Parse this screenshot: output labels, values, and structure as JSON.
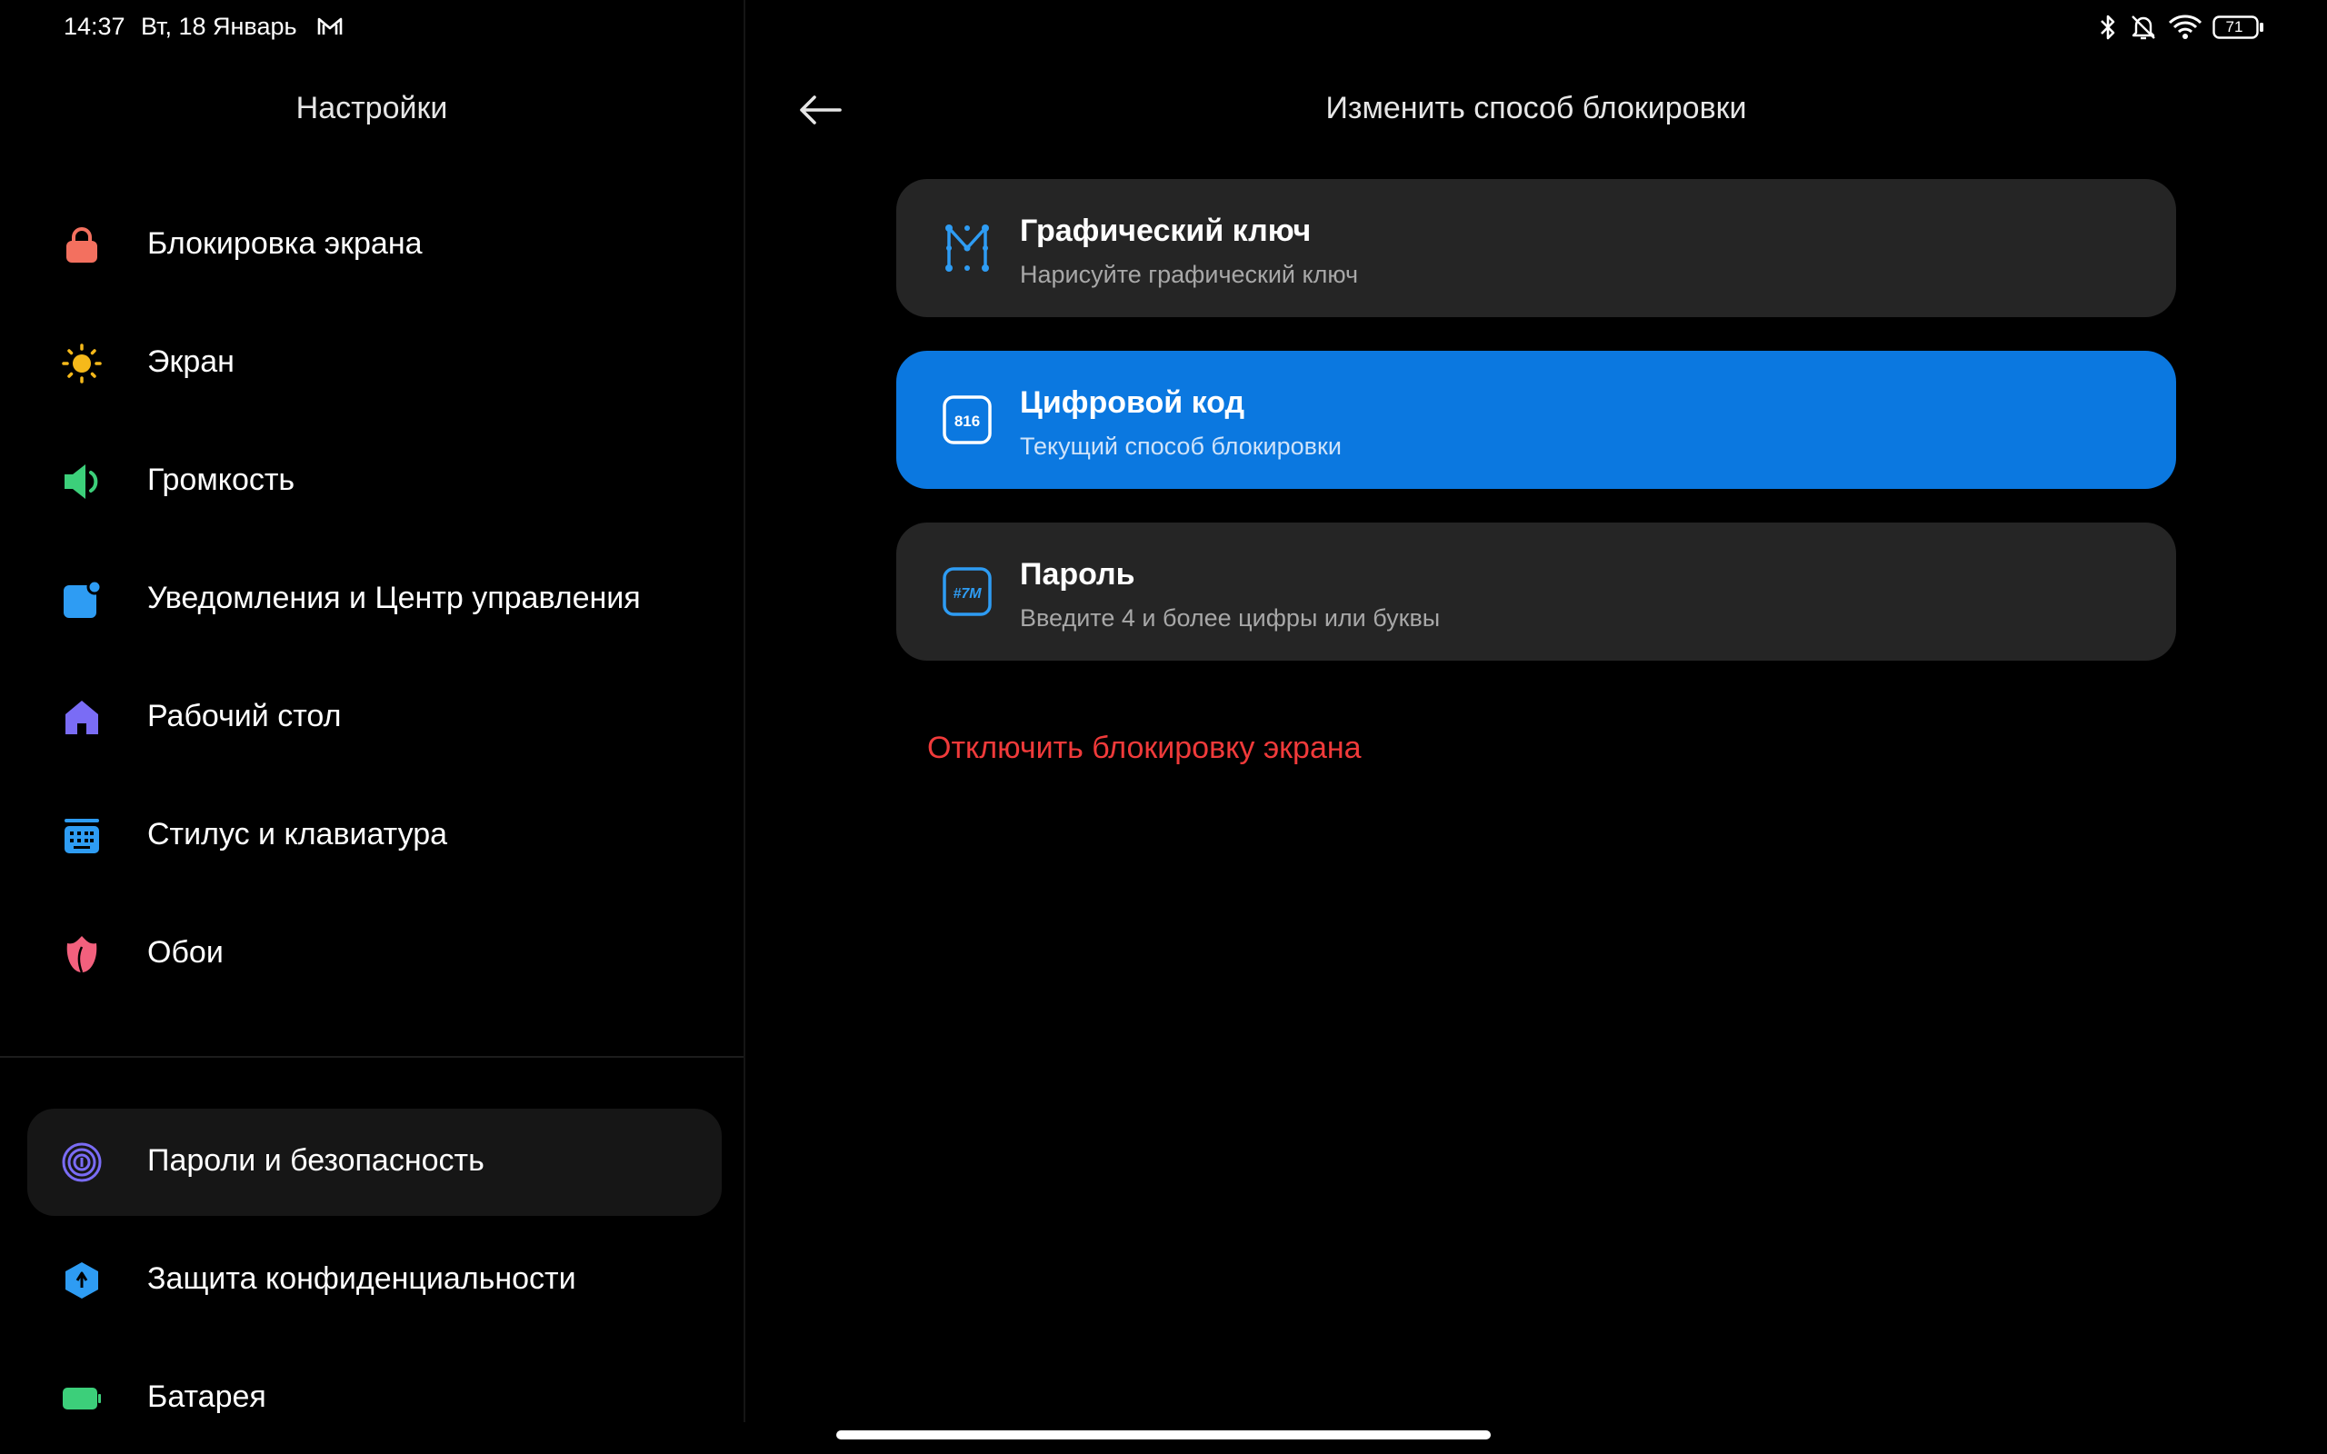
{
  "status_bar": {
    "time": "14:37",
    "date": "Вт, 18 Январь",
    "battery": "71",
    "icons": [
      "mail-icon",
      "bluetooth-icon",
      "mute-bell-icon",
      "wifi-icon",
      "battery-icon"
    ]
  },
  "sidebar": {
    "title": "Настройки",
    "items": [
      {
        "label": "Блокировка экрана",
        "icon": "lock-icon",
        "color": "#f3705f"
      },
      {
        "label": "Экран",
        "icon": "sun-icon",
        "color": "#f6b91a"
      },
      {
        "label": "Громкость",
        "icon": "speaker-icon",
        "color": "#3ccf7a"
      },
      {
        "label": "Уведомления и Центр управления",
        "icon": "notification-icon",
        "color": "#2e9cf3"
      },
      {
        "label": "Рабочий стол",
        "icon": "home-icon",
        "color": "#7a6cf5"
      },
      {
        "label": "Стилус и клавиатура",
        "icon": "keyboard-icon",
        "color": "#2e9cf3"
      },
      {
        "label": "Обои",
        "icon": "tulip-icon",
        "color": "#f2607d"
      },
      {
        "label": "Пароли и безопасность",
        "icon": "fingerprint-icon",
        "color": "#7a6cf5",
        "selected": true
      },
      {
        "label": "Защита конфиденциальности",
        "icon": "privacy-shield-icon",
        "color": "#2e9cf3"
      },
      {
        "label": "Батарея",
        "icon": "battery-icon",
        "color": "#3ccf7a"
      }
    ]
  },
  "detail": {
    "title": "Изменить способ блокировки",
    "options": [
      {
        "title": "Графический ключ",
        "subtitle": "Нарисуйте графический ключ",
        "icon": "pattern-icon"
      },
      {
        "title": "Цифровой код",
        "subtitle": "Текущий способ блокировки",
        "icon": "pin-icon",
        "icon_text": "816",
        "active": true
      },
      {
        "title": "Пароль",
        "subtitle": "Введите 4 и более цифры или буквы",
        "icon": "password-icon",
        "icon_text": "#7M"
      }
    ],
    "disable_label": "Отключить блокировку экрана"
  },
  "colors": {
    "accent": "#0b78e0",
    "danger": "#f03a3a",
    "card": "#252525"
  }
}
